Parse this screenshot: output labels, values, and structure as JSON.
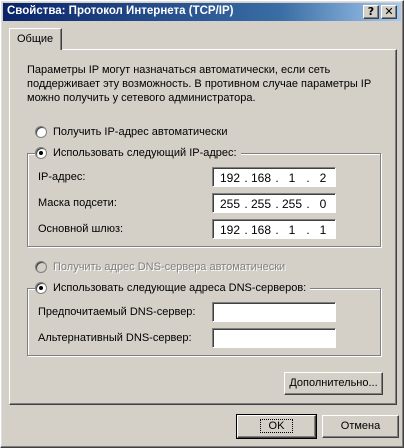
{
  "window": {
    "title": "Свойства: Протокол Интернета (TCP/IP)",
    "help_button": "?",
    "close_button": "✕"
  },
  "tabs": [
    {
      "label": "Общие",
      "active": true
    }
  ],
  "description": "Параметры IP могут назначаться автоматически, если сеть поддерживает эту возможность. В противном случае параметры IP можно получить у сетевого администратора.",
  "ip_settings": {
    "auto_label": "Получить IP-адрес автоматически",
    "auto_selected": false,
    "manual_label": "Использовать следующий IP-адрес:",
    "manual_selected": true,
    "fields": [
      {
        "label": "IP-адрес:",
        "octets": [
          "192",
          "168",
          "1",
          "2"
        ]
      },
      {
        "label": "Маска подсети:",
        "octets": [
          "255",
          "255",
          "255",
          "0"
        ]
      },
      {
        "label": "Основной шлюз:",
        "octets": [
          "192",
          "168",
          "1",
          "1"
        ]
      }
    ]
  },
  "dns_settings": {
    "auto_label": "Получить адрес DNS-сервера автоматически",
    "auto_selected": false,
    "auto_disabled": true,
    "manual_label": "Использовать следующие адреса DNS-серверов:",
    "manual_selected": true,
    "fields": [
      {
        "label": "Предпочитаемый DNS-сервер:",
        "octets": [
          "",
          "",
          "",
          ""
        ]
      },
      {
        "label": "Альтернативный DNS-сервер:",
        "octets": [
          "",
          "",
          "",
          ""
        ]
      }
    ]
  },
  "buttons": {
    "advanced": "Дополнительно...",
    "ok": "OK",
    "cancel": "Отмена"
  },
  "separator": "."
}
